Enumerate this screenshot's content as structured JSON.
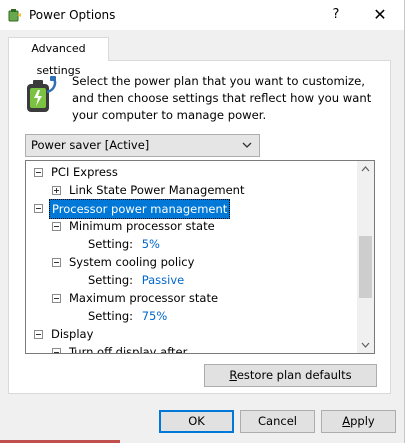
{
  "window": {
    "title": "Power Options",
    "help_glyph": "?",
    "close_glyph": "✕"
  },
  "tabs": [
    {
      "label": "Advanced settings",
      "active": true
    }
  ],
  "description": "Select the power plan that you want to customize, and then choose settings that reflect how you want your computer to manage power.",
  "plan_select": {
    "value": "Power saver [Active]"
  },
  "tree": {
    "items": [
      {
        "label": "PCI Express",
        "expander": "minus",
        "level": 0
      },
      {
        "label": "Link State Power Management",
        "expander": "plus",
        "level": 1
      },
      {
        "label": "Processor power management",
        "expander": "minus",
        "level": 0,
        "selected": true
      },
      {
        "label": "Minimum processor state",
        "expander": "minus",
        "level": 1
      },
      {
        "label": "Setting:",
        "value": "5%",
        "level": 2
      },
      {
        "label": "System cooling policy",
        "expander": "minus",
        "level": 1
      },
      {
        "label": "Setting:",
        "value": "Passive",
        "level": 2
      },
      {
        "label": "Maximum processor state",
        "expander": "minus",
        "level": 1
      },
      {
        "label": "Setting:",
        "value": "75%",
        "level": 2
      },
      {
        "label": "Display",
        "expander": "minus",
        "level": 0
      },
      {
        "label": "Turn off display after",
        "expander": "minus",
        "level": 1
      }
    ],
    "scroll_position": 0.55
  },
  "buttons": {
    "restore": {
      "label": "Restore plan defaults",
      "mnemonic": "R",
      "rest": "estore plan defaults"
    },
    "ok": {
      "label": "OK"
    },
    "cancel": {
      "label": "Cancel"
    },
    "apply": {
      "label": "Apply",
      "mnemonic": "A",
      "rest": "pply"
    }
  },
  "colors": {
    "accent": "#0078d7",
    "setting_value": "#0066cc",
    "window_bg": "#f0f0f0"
  },
  "icons": [
    "power-options-icon",
    "help-icon",
    "close-icon",
    "battery-plug-icon",
    "chevron-down-icon",
    "scroll-up-icon",
    "scroll-down-icon"
  ]
}
